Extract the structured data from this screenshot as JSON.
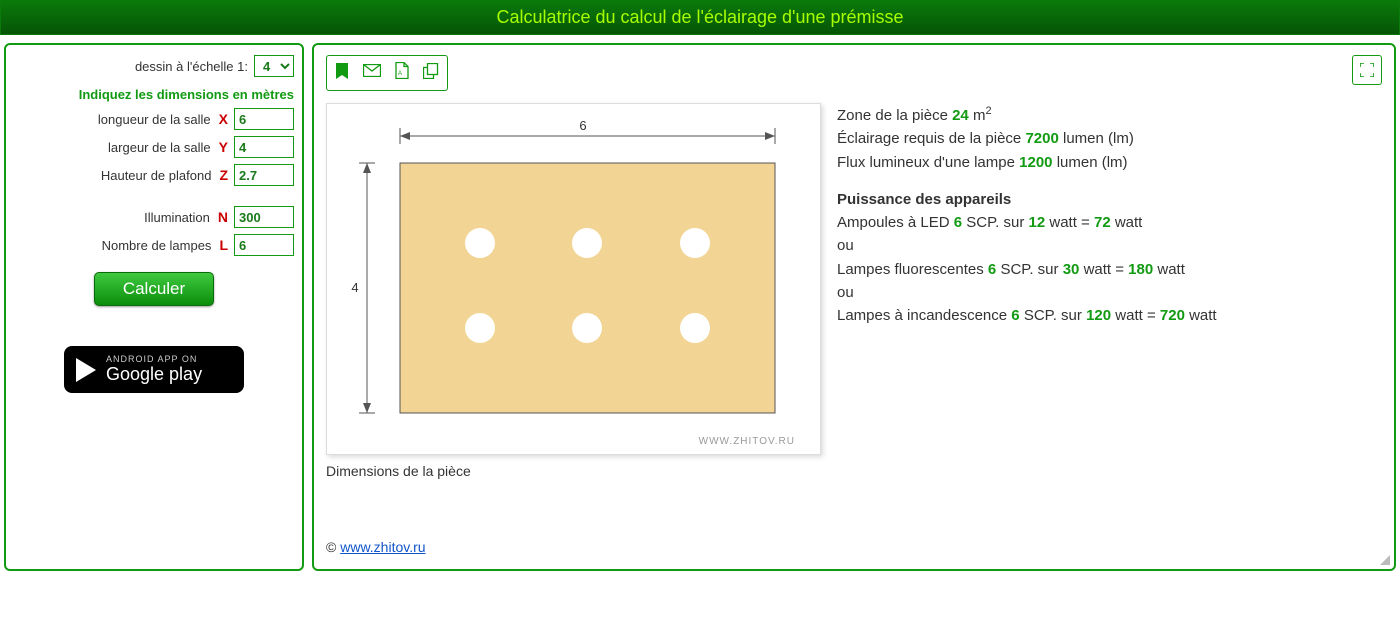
{
  "title": "Calculatrice du calcul de l'éclairage d'une prémisse",
  "left": {
    "scale_label": "dessin à l'échelle 1:",
    "scale_value": "4",
    "dims_header": "Indiquez les dimensions en mètres",
    "length_label": "longueur de la salle",
    "length_axis": "X",
    "length_value": "6",
    "width_label": "largeur de la salle",
    "width_axis": "Y",
    "width_value": "4",
    "height_label": "Hauteur de plafond",
    "height_axis": "Z",
    "height_value": "2.7",
    "illum_label": "Illumination",
    "illum_axis": "N",
    "illum_value": "300",
    "lamps_label": "Nombre de lampes",
    "lamps_axis": "L",
    "lamps_value": "6",
    "calc_btn": "Calculer",
    "gplay_small": "ANDROID APP ON",
    "gplay_big": "Google play"
  },
  "toolbar": {
    "bookmark": "bookmark-icon",
    "mail": "mail-icon",
    "pdf": "pdf-icon",
    "copy": "copy-icon",
    "fullscreen": "fullscreen-icon"
  },
  "drawing": {
    "top_dim": "6",
    "left_dim": "4",
    "watermark": "WWW.ZHITOV.RU",
    "caption": "Dimensions de la pièce"
  },
  "results": {
    "area_label": "Zone de la pièce",
    "area_value": "24",
    "area_unit_prefix": "m",
    "area_unit_sup": "2",
    "req_label": "Éclairage requis de la pièce",
    "req_value": "7200",
    "req_unit": "lumen (lm)",
    "flux_label": "Flux lumineux d'une lampe",
    "flux_value": "1200",
    "flux_unit": "lumen (lm)",
    "power_header": "Puissance des appareils",
    "led_prefix": "Ampoules à LED",
    "led_count": "6",
    "scp": "SCP. sur",
    "led_watt": "12",
    "watt_eq": "watt =",
    "led_total": "72",
    "watt": "watt",
    "or": "ou",
    "fluor_prefix": "Lampes fluorescentes",
    "fluor_count": "6",
    "fluor_watt": "30",
    "fluor_total": "180",
    "inc_prefix": "Lampes à incandescence",
    "inc_count": "6",
    "inc_watt": "120",
    "inc_total": "720"
  },
  "footer": {
    "copyright": "©",
    "link_text": "www.zhitov.ru"
  }
}
